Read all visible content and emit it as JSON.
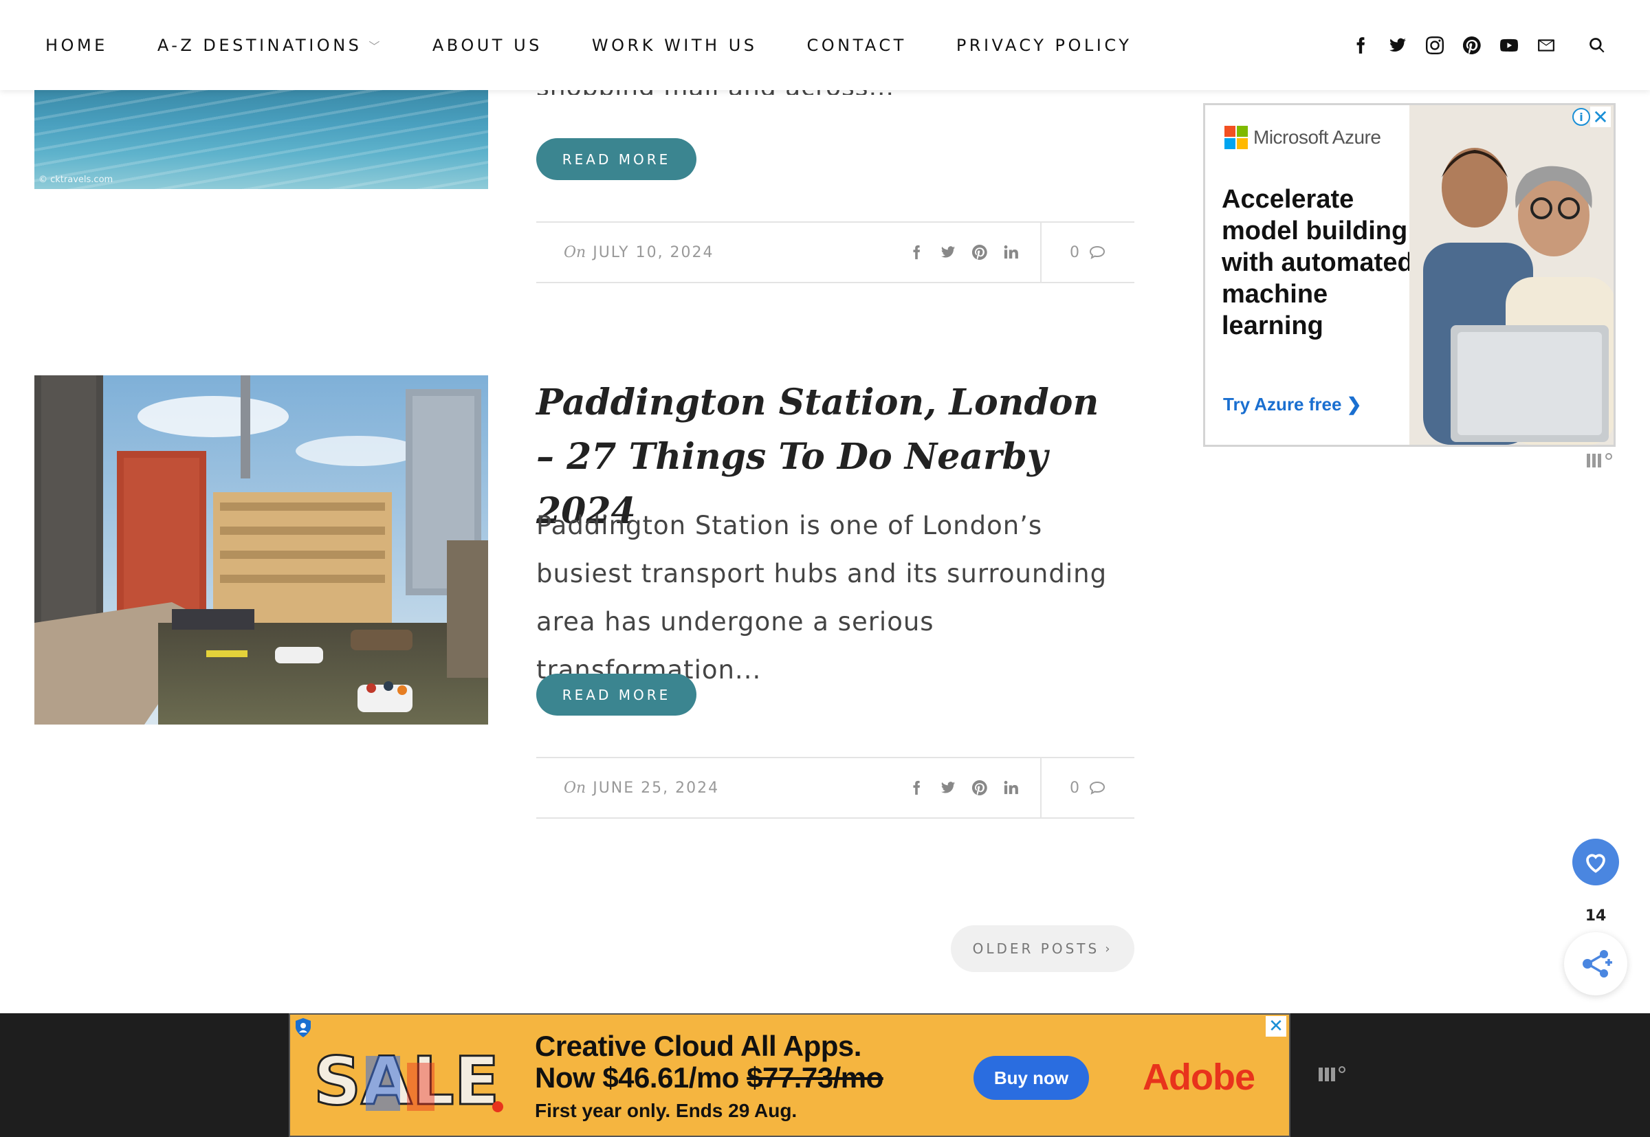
{
  "nav": {
    "items": [
      {
        "label": "HOME"
      },
      {
        "label": "A-Z DESTINATIONS"
      },
      {
        "label": "ABOUT US"
      },
      {
        "label": "WORK WITH US"
      },
      {
        "label": "CONTACT"
      },
      {
        "label": "PRIVACY POLICY"
      }
    ],
    "icons": [
      "facebook-icon",
      "twitter-icon",
      "instagram-icon",
      "pinterest-icon",
      "youtube-icon",
      "mail-icon",
      "search-icon"
    ]
  },
  "posts": [
    {
      "image_watermark": "© cktravels.com",
      "excerpt_tail": "shopping mall and across...",
      "read_more": "READ MORE",
      "meta": {
        "on": "On",
        "date": "JULY 10, 2024",
        "comments": "0"
      }
    },
    {
      "title": "Paddington Station, London – 27 Things To Do Nearby 2024",
      "excerpt": "Paddington Station is one of London’s busiest transport hubs  and its surrounding area has undergone a serious transformation...",
      "read_more": "READ MORE",
      "meta": {
        "on": "On",
        "date": "JUNE 25, 2024",
        "comments": "0"
      }
    }
  ],
  "pagination": {
    "older_posts": "OLDER POSTS"
  },
  "sidebar_ad": {
    "brand": "Microsoft Azure",
    "headline": "Accelerate model building with automated machine learning",
    "cta": "Try Azure free",
    "info": "i",
    "close": "✕"
  },
  "floating": {
    "share_count": "14"
  },
  "bottom_ad": {
    "line1": "Creative Cloud All Apps.",
    "line2_price": "Now $46.61/mo",
    "line2_old": "$77.73/mo",
    "line3": "First year only. Ends 29 Aug.",
    "buy": "Buy now",
    "brand": "Adobe",
    "close": "✕"
  },
  "colors": {
    "accent": "#3b8590",
    "azure_link": "#1a6fd0",
    "adobe_red": "#e8331c",
    "banner_bg": "#f5b540"
  }
}
